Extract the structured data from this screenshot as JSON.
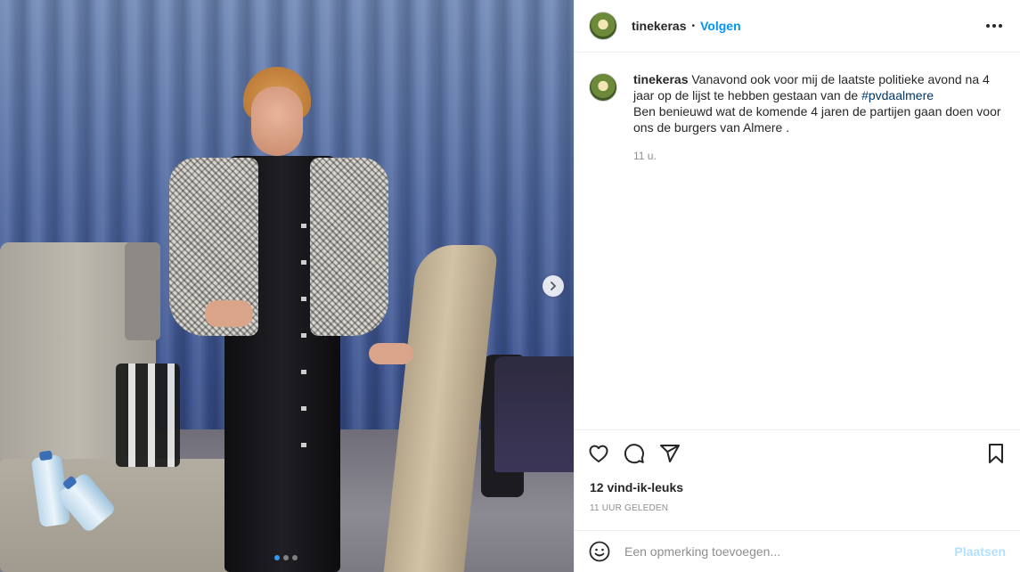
{
  "post": {
    "username": "tinekeras",
    "follow_label": "Volgen",
    "separator": "•",
    "caption": {
      "username": "tinekeras",
      "text_before_hashtag": " Vanavond ook voor mij de laatste politieke avond na 4 jaar op de lijst te hebben gestaan van de ",
      "hashtag": "#pvdaalmere",
      "text_after_hashtag": "Ben benieuwd wat de komende 4 jaren de partijen gaan doen voor ons de burgers van Almere ."
    },
    "caption_time": "11 u.",
    "likes": "12 vind-ik-leuks",
    "posted_ago": "11 UUR GELEDEN",
    "comment": {
      "placeholder": "Een opmerking toevoegen...",
      "post_label": "Plaatsen"
    },
    "carousel": {
      "slides": 3,
      "active_index": 0
    },
    "colors": {
      "accent": "#0095f6",
      "hashtag": "#00376b",
      "post_disabled": "#b2dffc",
      "muted": "#8e8e8e"
    },
    "icons": {
      "like": "heart-icon",
      "comment": "comment-bubble-icon",
      "share": "paper-plane-icon",
      "save": "bookmark-icon",
      "emoji": "smiley-icon",
      "more": "more-options-icon",
      "next": "chevron-right-icon"
    }
  }
}
